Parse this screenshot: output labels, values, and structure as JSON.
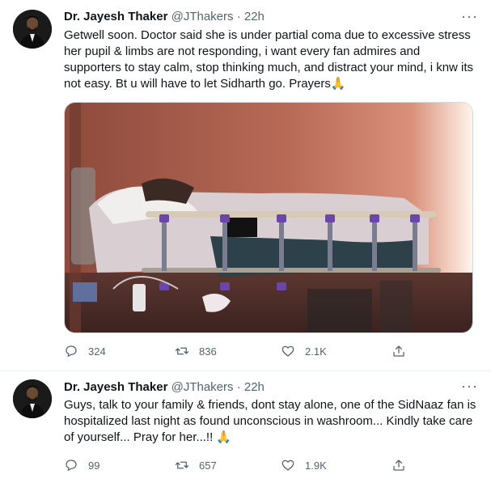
{
  "tweets": [
    {
      "author_name": "Dr. Jayesh Thaker",
      "author_handle": "@JThakers",
      "separator": "·",
      "time": "22h",
      "more": "···",
      "text": "Getwell soon. Doctor said she is under partial coma due to excessive stress her pupil & limbs are not responding, i want every fan admires and supporters to stay calm, stop thinking much, and distract your mind, i knw its not easy. Bt u will have to let Sidharth go. Prayers",
      "emoji": "🙏",
      "has_media": true,
      "reply_count": "324",
      "retweet_count": "836",
      "like_count": "2.1K"
    },
    {
      "author_name": "Dr. Jayesh Thaker",
      "author_handle": "@JThakers",
      "separator": "·",
      "time": "22h",
      "more": "···",
      "text": "Guys, talk to your family & friends, dont stay alone, one of the SidNaaz fan is hospitalized last night as found unconscious in washroom... Kindly take care of yourself... Pray for her...!! ",
      "emoji": "🙏",
      "has_media": false,
      "reply_count": "99",
      "retweet_count": "657",
      "like_count": "1.9K"
    }
  ],
  "icons": {
    "reply": "reply-icon",
    "retweet": "retweet-icon",
    "like": "like-icon",
    "share": "share-icon",
    "more": "more-icon"
  },
  "colors": {
    "text_primary": "#0f1419",
    "text_secondary": "#536471",
    "divider": "#eff3f4"
  }
}
